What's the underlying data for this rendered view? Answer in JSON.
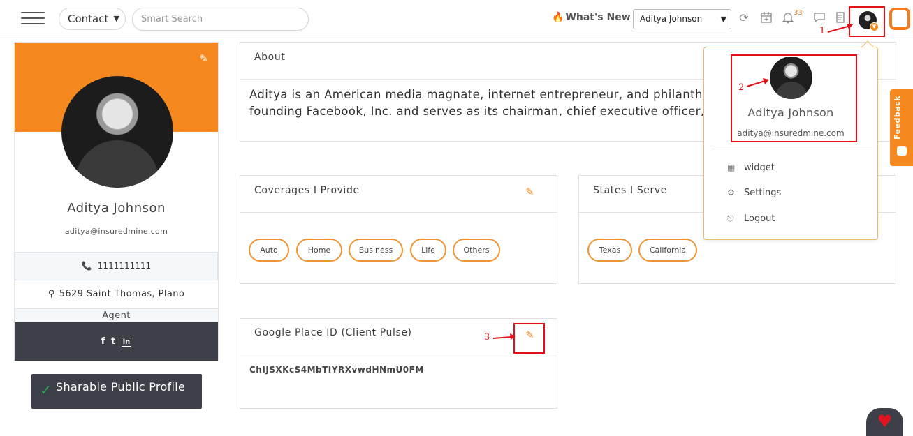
{
  "topbar": {
    "contact_select": "Contact",
    "search_placeholder": "Smart Search",
    "whats_new": "What's New",
    "user_select": "Aditya Johnson",
    "notification_count": "33"
  },
  "annotations": {
    "one": "1",
    "two": "2",
    "three": "3",
    "color": "#e3101a"
  },
  "profile": {
    "name": "Aditya Johnson",
    "email": "aditya@insuredmine.com",
    "phone": "1111111111",
    "address": "5629 Saint Thomas, Plano",
    "role": "Agent",
    "social": [
      "f",
      "t",
      "in"
    ],
    "share_label": "Sharable Public Profile"
  },
  "about": {
    "title": "About",
    "line1": "Aditya is an American media magnate, internet entrepreneur, and philanthropist. He is known for co-",
    "line2": "founding Facebook, Inc. and serves as its chairman, chief executive officer, and controlling shareholder."
  },
  "coverages": {
    "title": "Coverages I Provide",
    "items": [
      "Auto",
      "Home",
      "Business",
      "Life",
      "Others"
    ]
  },
  "states": {
    "title": "States I Serve",
    "items": [
      "Texas",
      "California"
    ]
  },
  "google_place": {
    "title": "Google Place ID (Client Pulse)",
    "value": "ChIJSXKcS4MbTIYRXvwdHNmU0FM"
  },
  "dropdown": {
    "name": "Aditya Johnson",
    "email": "aditya@insuredmine.com",
    "items": [
      "widget",
      "Settings",
      "Logout"
    ]
  },
  "feedback_label": "Feedback",
  "colors": {
    "accent": "#f5891f",
    "dark": "#3d4049",
    "heart": "#e0141e"
  }
}
